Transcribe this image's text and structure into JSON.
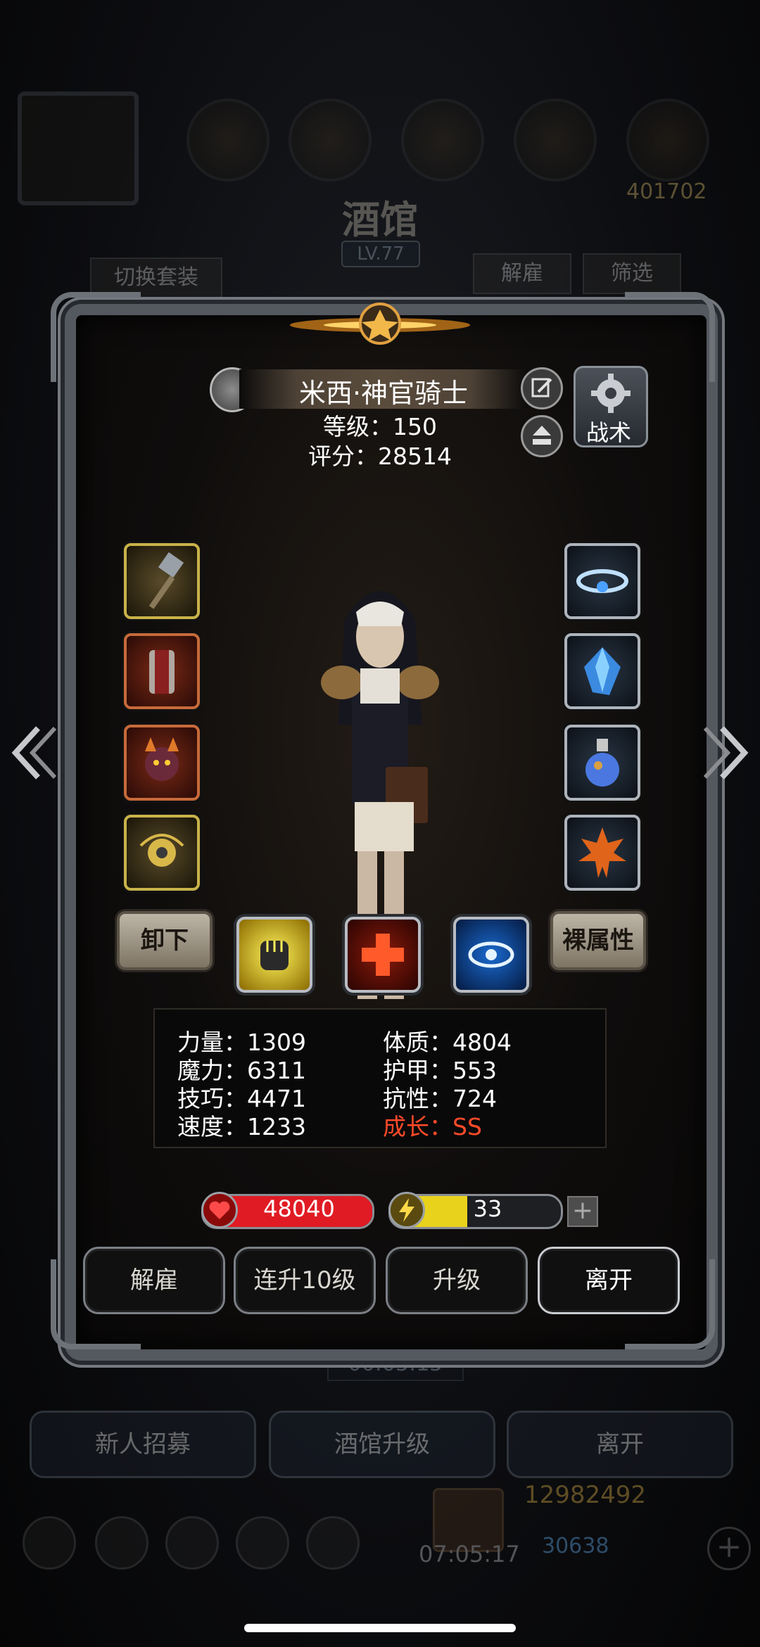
{
  "background": {
    "title": "酒馆",
    "level": "LV.77",
    "switch_outfit": "切换套装",
    "dismiss_bg": "解雇",
    "filter": "筛选",
    "timer": "00:05:15",
    "bottom_buttons": [
      "新人招募",
      "酒馆升级",
      "离开"
    ],
    "gold": "12982492",
    "gems": "30638",
    "chest_timer": "07:05:17",
    "header_partial_number": "401702"
  },
  "hero": {
    "name": "米西·神官骑士",
    "level_label": "等级：150",
    "score_label": "评分：28514"
  },
  "tactics_label": "战术",
  "equipment_left": [
    "mace-icon",
    "armor-icon",
    "demon-mask-icon",
    "golden-amulet-icon"
  ],
  "equipment_right": [
    "ice-ring-icon",
    "blue-crystal-icon",
    "potion-icon",
    "maple-leaf-icon"
  ],
  "unequip_label": "卸下",
  "naked_attr_label": "裸属性",
  "skills": [
    "fist-icon",
    "cross-icon",
    "eye-icon"
  ],
  "stats": {
    "strength": "力量：1309",
    "magic": "魔力：6311",
    "skill": "技巧：4471",
    "speed": "速度：1233",
    "constitution": "体质：4804",
    "armor": "护甲：553",
    "resistance": "抗性：724",
    "growth": "成长：SS"
  },
  "hp": {
    "value": "48040",
    "fill": 1.0,
    "color": "#e01b24"
  },
  "energy": {
    "value": "33",
    "fill": 0.45,
    "color": "#e8d21c"
  },
  "plus_label": "+",
  "actions": [
    "解雇",
    "连升10级",
    "升级",
    "离开"
  ]
}
